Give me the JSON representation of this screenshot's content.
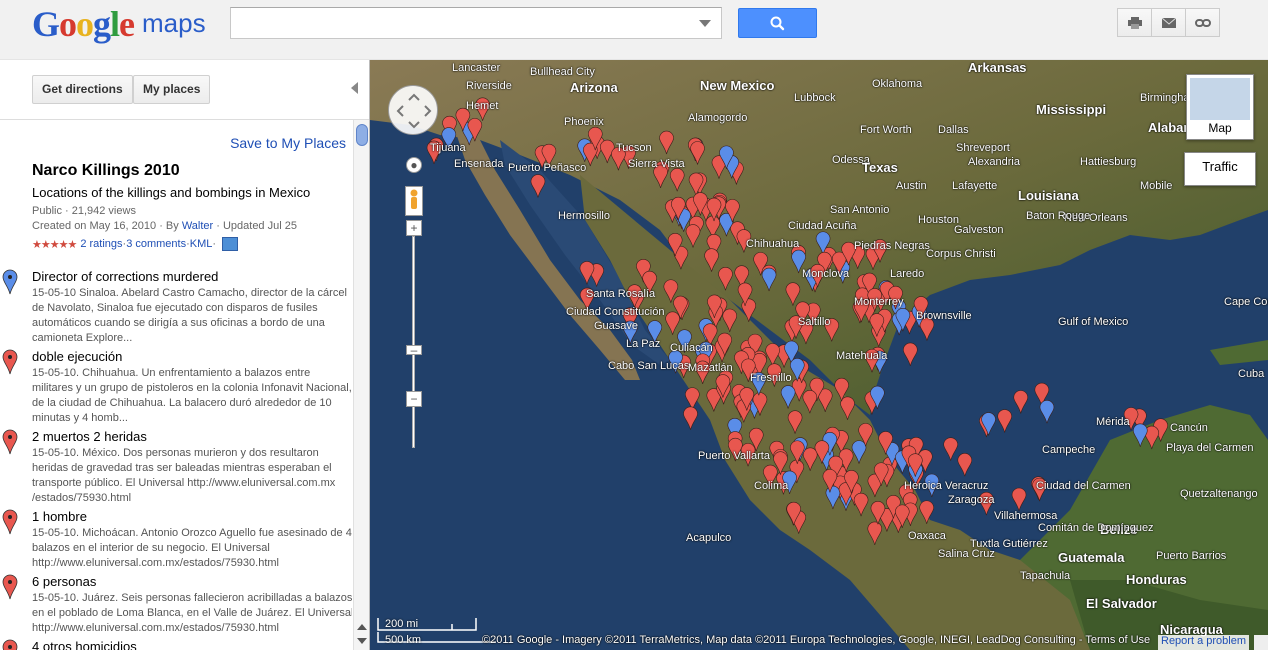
{
  "logo": {
    "g1": "G",
    "o1": "o",
    "o2": "o",
    "g2": "g",
    "l": "l",
    "e": "e",
    "maps": "maps"
  },
  "search": {
    "value": "",
    "placeholder": ""
  },
  "header_icons": [
    "print-icon",
    "email-icon",
    "link-icon"
  ],
  "panel": {
    "get_directions": "Get directions",
    "my_places": "My places",
    "save_link": "Save to My Places",
    "title": "Narco Killings 2010",
    "subtitle": "Locations of the killings and bombings in Mexico",
    "meta_views": "Public · 21,942 views",
    "meta_created_prefix": "Created on May 16, 2010 · By ",
    "meta_author": "Walter",
    "meta_updated": " · Updated Jul 25",
    "stars": "★★★★★",
    "ratings": "2 ratings",
    "sep1": " · ",
    "comments": "3 comments",
    "sep2": " · ",
    "kml": "KML",
    "sep3": " · ",
    "places": [
      {
        "title": "Director of corrections murdered",
        "desc": "15-05-10 Sinaloa. Abelard Castro Camacho, director de la cárcel de Navolato, Sinaloa fue ejecutado con disparos de fusiles automáticos cuando se dirigía a sus oficinas a bordo de una camioneta Explore...",
        "color": "blue"
      },
      {
        "title": "doble ejecución",
        "desc": "15-05-10. Chihuahua. Un enfrentamiento a balazos entre militares y un grupo de pistoleros en la colonia Infonavit Nacional, de la ciudad de Chihuahua. La balacero duró alrededor de 10 minutas y 4 homb...",
        "color": "red"
      },
      {
        "title": "2 muertos 2 heridas",
        "desc": "15-05-10. México. Dos personas murieron y dos resultaron heridas de gravedad tras ser baleadas mientras esperaban el transporte público. El Universal http://www.eluniversal.com.mx /estados/75930.html",
        "color": "red"
      },
      {
        "title": "1 hombre",
        "desc": "15-05-10. Michoácan. Antonio Orozco Aguello fue asesinado de 4 balazos en el interior de su negocio. El Universal http://www.eluniversal.com.mx/estados/75930.html",
        "color": "red"
      },
      {
        "title": "6 personas",
        "desc": "15-05-10. Juárez. Seis personas fallecieron acribilladas a balazos en el poblado de Loma Blanca, en el Valle de Juárez. El Universal http://www.eluniversal.com.mx/estados/75930.html",
        "color": "red"
      },
      {
        "title": "4 otros homicidios",
        "desc": "",
        "color": "red"
      }
    ]
  },
  "map": {
    "labels": [
      {
        "text": "Arkansas",
        "cls": "big"
      },
      {
        "text": "Lancaster",
        "cls": ""
      },
      {
        "text": "Bullhead City",
        "cls": ""
      },
      {
        "text": "New Mexico",
        "cls": "big"
      },
      {
        "text": "Oklahoma",
        "cls": ""
      },
      {
        "text": "Riverside",
        "cls": ""
      },
      {
        "text": "Arizona",
        "cls": "big"
      },
      {
        "text": "Lubbock",
        "cls": ""
      },
      {
        "text": "Mississippi",
        "cls": "big"
      },
      {
        "text": "Alamogordo",
        "cls": ""
      },
      {
        "text": "Birmingham",
        "cls": ""
      },
      {
        "text": "Hemet",
        "cls": ""
      },
      {
        "text": "Phoenix",
        "cls": ""
      },
      {
        "text": "Fort Worth",
        "cls": ""
      },
      {
        "text": "Dallas",
        "cls": ""
      },
      {
        "text": "Alabama",
        "cls": "big"
      },
      {
        "text": "Tijuana",
        "cls": ""
      },
      {
        "text": "Tucson",
        "cls": ""
      },
      {
        "text": "Shreveport",
        "cls": ""
      },
      {
        "text": "Ensenada",
        "cls": ""
      },
      {
        "text": "Sierra Vista",
        "cls": ""
      },
      {
        "text": "Odessa",
        "cls": ""
      },
      {
        "text": "Alexandria",
        "cls": ""
      },
      {
        "text": "Hattiesburg",
        "cls": ""
      },
      {
        "text": "Texas",
        "cls": "big"
      },
      {
        "text": "Puerto Peñasco",
        "cls": ""
      },
      {
        "text": "Austin",
        "cls": ""
      },
      {
        "text": "Lafayette",
        "cls": ""
      },
      {
        "text": "Mobile",
        "cls": ""
      },
      {
        "text": "Louisiana",
        "cls": "big"
      },
      {
        "text": "San Antonio",
        "cls": ""
      },
      {
        "text": "Houston",
        "cls": ""
      },
      {
        "text": "New Orleans",
        "cls": ""
      },
      {
        "text": "Baton Rouge",
        "cls": ""
      },
      {
        "text": "Hermosillo",
        "cls": ""
      },
      {
        "text": "Chihuahua",
        "cls": ""
      },
      {
        "text": "Ciudad Acuña",
        "cls": ""
      },
      {
        "text": "Piedras Negras",
        "cls": ""
      },
      {
        "text": "Galveston",
        "cls": ""
      },
      {
        "text": "Corpus Christi",
        "cls": ""
      },
      {
        "text": "Monclova",
        "cls": ""
      },
      {
        "text": "Laredo",
        "cls": ""
      },
      {
        "text": "Santa Rosalía",
        "cls": ""
      },
      {
        "text": "Monterrey",
        "cls": ""
      },
      {
        "text": "Cape Coral",
        "cls": ""
      },
      {
        "text": "Ciudad Constitución",
        "cls": ""
      },
      {
        "text": "Saltillo",
        "cls": ""
      },
      {
        "text": "Brownsville",
        "cls": ""
      },
      {
        "text": "Guasave",
        "cls": ""
      },
      {
        "text": "Gulf of Mexico",
        "cls": ""
      },
      {
        "text": "La Paz",
        "cls": ""
      },
      {
        "text": "Culiacán",
        "cls": ""
      },
      {
        "text": "Matehuala",
        "cls": ""
      },
      {
        "text": "Cabo San Lucas",
        "cls": ""
      },
      {
        "text": "Mazatlán",
        "cls": ""
      },
      {
        "text": "Fresnillo",
        "cls": ""
      },
      {
        "text": "Puerto Vallarta",
        "cls": ""
      },
      {
        "text": "Mérida",
        "cls": ""
      },
      {
        "text": "Cancún",
        "cls": ""
      },
      {
        "text": "Playa del Carmen",
        "cls": ""
      },
      {
        "text": "Campeche",
        "cls": ""
      },
      {
        "text": "Colima",
        "cls": ""
      },
      {
        "text": "Heroica Veracruz",
        "cls": ""
      },
      {
        "text": "Ciudad del Carmen",
        "cls": ""
      },
      {
        "text": "Zaragoza",
        "cls": ""
      },
      {
        "text": "Villahermosa",
        "cls": ""
      },
      {
        "text": "Belize",
        "cls": "country"
      },
      {
        "text": "Oaxaca",
        "cls": ""
      },
      {
        "text": "Comitán de Domínguez",
        "cls": ""
      },
      {
        "text": "Acapulco",
        "cls": ""
      },
      {
        "text": "Tuxtla Gutiérrez",
        "cls": ""
      },
      {
        "text": "Salina Cruz",
        "cls": ""
      },
      {
        "text": "Guatemala",
        "cls": "country"
      },
      {
        "text": "Puerto Barrios",
        "cls": ""
      },
      {
        "text": "Tapachula",
        "cls": ""
      },
      {
        "text": "Honduras",
        "cls": "country"
      },
      {
        "text": "El Salvador",
        "cls": "country"
      },
      {
        "text": "Nicaragua",
        "cls": "country"
      },
      {
        "text": "Quetzaltenango",
        "cls": ""
      },
      {
        "text": "Cuba",
        "cls": ""
      }
    ],
    "maptype_label": "Map",
    "traffic_label": "Traffic",
    "scale_mi": "200 mi",
    "scale_km": "500 km",
    "copyright": "©2011 Google - Imagery ©2011 TerraMetrics, Map data ©2011 Europa Technologies, Google, INEGI, LeadDog Consulting - Terms of Use",
    "report": "Report a problem"
  },
  "colors": {
    "red_pin": "#e8574f",
    "blue_pin": "#5a8de8",
    "search_button": "#4d90fe",
    "link": "#1f4fb5"
  }
}
